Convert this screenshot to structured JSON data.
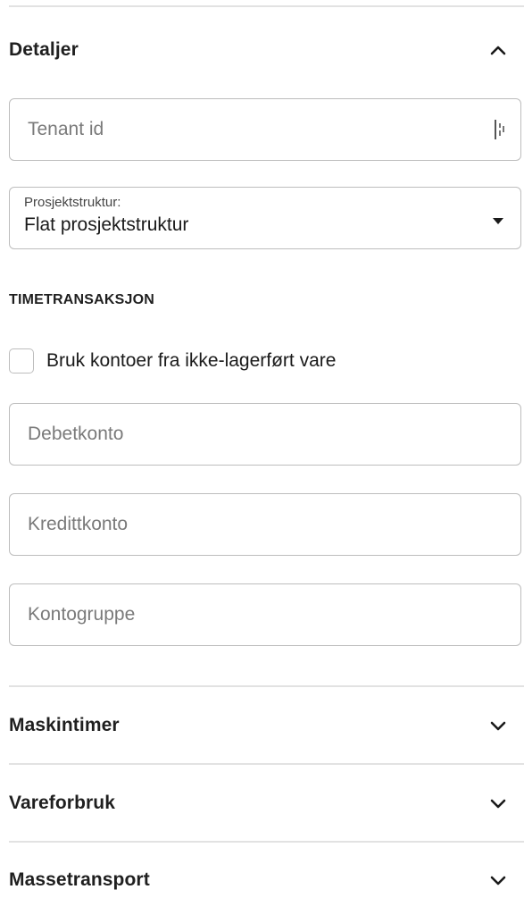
{
  "sections": {
    "detaljer": {
      "title": "Detaljer",
      "expanded": true
    },
    "maskintimer": {
      "title": "Maskintimer",
      "expanded": false
    },
    "vareforbruk": {
      "title": "Vareforbruk",
      "expanded": false
    },
    "massetransport": {
      "title": "Massetransport",
      "expanded": false
    }
  },
  "tenant": {
    "placeholder": "Tenant id",
    "value": "",
    "icon": "input-helper-icon"
  },
  "prosjektstruktur": {
    "label": "Prosjektstruktur:",
    "selected": "Flat prosjektstruktur",
    "icon": "caret-down-icon"
  },
  "timetransaksjon": {
    "heading": "TIMETRANSAKSJON",
    "checkbox_label": "Bruk kontoer fra ikke-lagerført vare",
    "checked": false,
    "debetkonto_placeholder": "Debetkonto",
    "kredittkonto_placeholder": "Kredittkonto",
    "kontogruppe_placeholder": "Kontogruppe"
  },
  "colors": {
    "border": "#bdbdbd",
    "divider": "#e2e2e2",
    "text": "#1a1a1a",
    "placeholder": "#7a7a7a"
  }
}
